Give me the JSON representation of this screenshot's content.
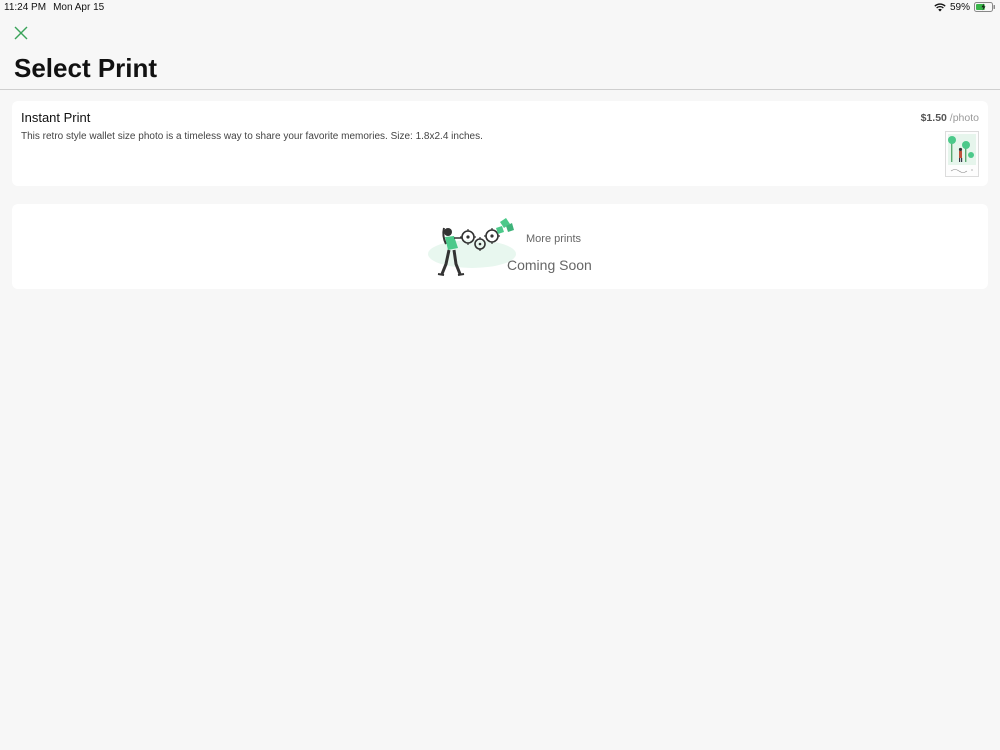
{
  "status_bar": {
    "time": "11:24 PM",
    "date": "Mon Apr 15",
    "battery_percent": "59%",
    "battery_level": 0.59,
    "charging": true
  },
  "header": {
    "close_icon": "close-icon",
    "title": "Select Print"
  },
  "prints": [
    {
      "name": "Instant Print",
      "description": "This retro style wallet size photo is a timeless way to share your favorite memories. Size: 1.8x2.4 inches.",
      "price": "$1.50",
      "price_unit": "/photo",
      "thumbnail_icon": "instant-print-thumbnail-icon"
    }
  ],
  "coming_soon": {
    "line1": "More prints",
    "line2": "Coming Soon",
    "illustration_icon": "person-pushing-gears-icon"
  },
  "colors": {
    "accent": "#3aa35a",
    "illustration_green": "#4cc98a",
    "background": "#f7f7f7",
    "card": "#ffffff"
  }
}
